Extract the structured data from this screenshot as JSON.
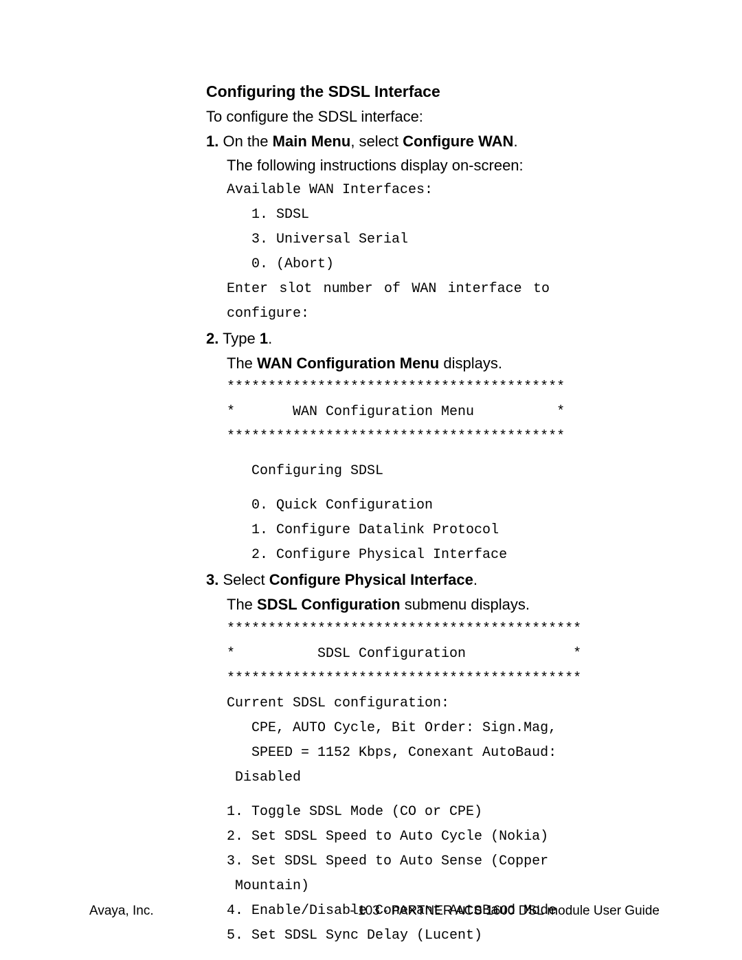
{
  "heading": "Configuring the SDSL Interface",
  "intro": "To configure the SDSL interface:",
  "step1": {
    "num": "1.",
    "text_pre": " On the ",
    "bold1": "Main Menu",
    "text_mid": ", select ",
    "bold2": "Configure WAN",
    "text_post": ".",
    "body": "The following instructions display on-screen:",
    "code1": "Available WAN Interfaces:",
    "code2": "   1. SDSL",
    "code3": "   3. Universal Serial",
    "code4": "   0. (Abort)",
    "code5": "Enter slot number of WAN interface to",
    "code6": "configure:"
  },
  "step2": {
    "num": "2.",
    "text_pre": " Type ",
    "bold1": "1",
    "text_post": ".",
    "body_pre": "The ",
    "body_bold": "WAN Configuration Menu",
    "body_post": " displays.",
    "code1": "*****************************************",
    "code2": "*       WAN Configuration Menu          *",
    "code3": "*****************************************",
    "code4": "   Configuring SDSL",
    "code5": "   0. Quick Configuration",
    "code6": "   1. Configure Datalink Protocol",
    "code7": "   2. Configure Physical Interface"
  },
  "step3": {
    "num": "3.",
    "text_pre": " Select ",
    "bold1": "Configure Physical Interface",
    "text_post": ".",
    "body_pre": "The ",
    "body_bold": "SDSL Configuration",
    "body_post": " submenu displays.",
    "code1": "*******************************************",
    "code2": "*          SDSL Configuration             *",
    "code3": "*******************************************",
    "code4": "Current SDSL configuration:",
    "code5": "   CPE, AUTO Cycle, Bit Order: Sign.Mag,",
    "code6": "   SPEED = 1152 Kbps, Conexant AutoBaud:",
    "code7": " Disabled",
    "code8": "1. Toggle SDSL Mode (CO or CPE)",
    "code9": "2. Set SDSL Speed to Auto Cycle (Nokia)",
    "code10": "3. Set SDSL Speed to Auto Sense (Copper",
    "code11": " Mountain)",
    "code12": "4. Enable/Disable Conexant AutoBaud Mode",
    "code13": "5. Set SDSL Sync Delay (Lucent)"
  },
  "footer": {
    "left": "Avaya, Inc.",
    "right": "- 103 - PARTNER ACS 1600 DSL module User Guide"
  }
}
